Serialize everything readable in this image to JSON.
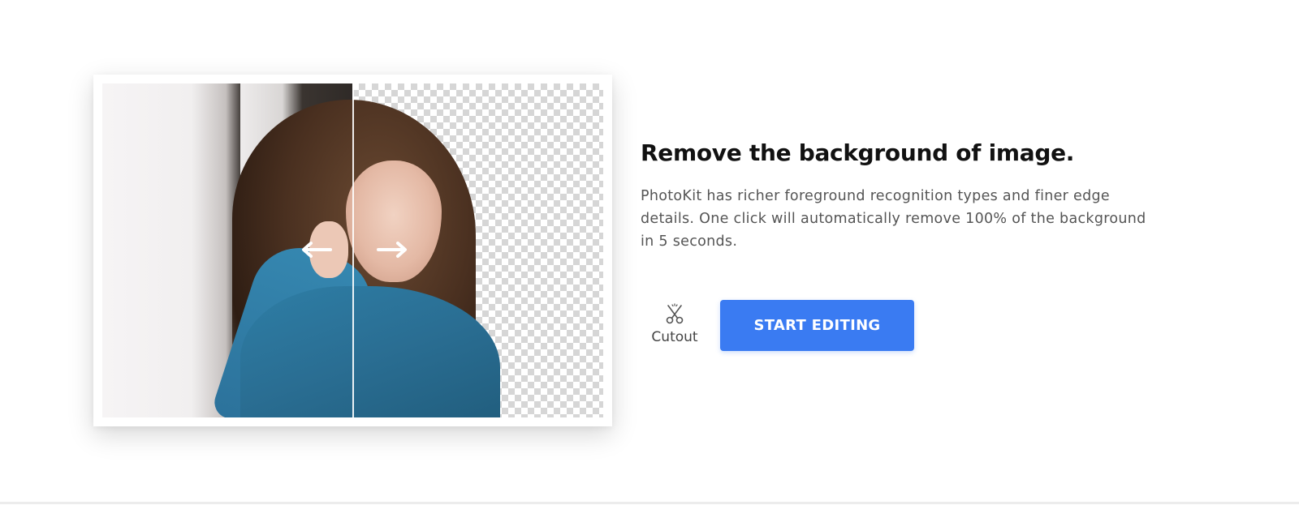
{
  "hero": {
    "image_alt": "Woman with curly hair — original vs background removed",
    "arrow_left_icon": "arrow-left-icon",
    "arrow_right_icon": "arrow-right-icon"
  },
  "content": {
    "title": "Remove the background of image.",
    "description": "PhotoKit has richer foreground recognition types and finer edge details. One click will automatically remove 100% of the background in 5 seconds."
  },
  "actions": {
    "cutout_icon": "scissors-icon",
    "cutout_label": "Cutout",
    "start_label": "START EDITING",
    "button_color": "#3a7bf2"
  }
}
